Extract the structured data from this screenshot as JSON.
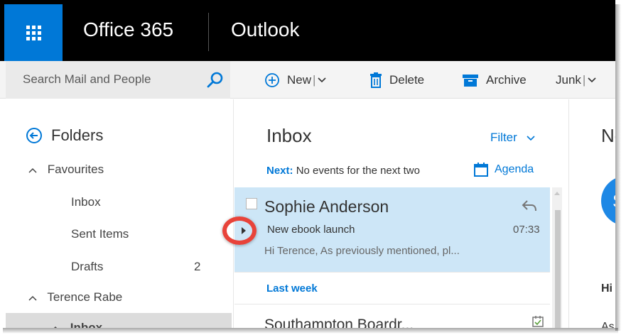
{
  "header": {
    "brand": "Office 365",
    "app_name": "Outlook"
  },
  "search": {
    "placeholder": "Search Mail and People"
  },
  "toolbar": {
    "new_label": "New",
    "delete_label": "Delete",
    "archive_label": "Archive",
    "junk_label": "Junk"
  },
  "folders": {
    "title": "Folders",
    "favourites_label": "Favourites",
    "items": [
      {
        "label": "Inbox"
      },
      {
        "label": "Sent Items"
      },
      {
        "label": "Drafts",
        "count": "2"
      }
    ],
    "account_label": "Terence Rabe",
    "account_inbox_label": "Inbox"
  },
  "list": {
    "title": "Inbox",
    "filter_label": "Filter",
    "next_prefix": "Next:",
    "next_text": "No events for the next two",
    "agenda_label": "Agenda",
    "selected_message": {
      "sender": "Sophie Anderson",
      "subject": "New ebook launch",
      "time": "07:33",
      "preview": "Hi Terence,  As previously mentioned, pl..."
    },
    "group_label": "Last week",
    "second_message": {
      "sender": "Southampton Boardr..."
    }
  },
  "reading": {
    "title": "Ne",
    "avatar_initial": "S",
    "greeting": "Hi T",
    "body": "As p"
  },
  "colors": {
    "accent": "#0078d7",
    "selected_row": "#cde6f7",
    "highlight_ring": "#e8433a",
    "topbar": "#000000"
  },
  "icons": [
    "app-launcher-icon",
    "search-icon",
    "plus-circle-icon",
    "chevron-down-icon",
    "trash-icon",
    "archive-icon",
    "back-arrow-icon",
    "calendar-icon",
    "reply-icon",
    "expand-arrow-icon"
  ]
}
